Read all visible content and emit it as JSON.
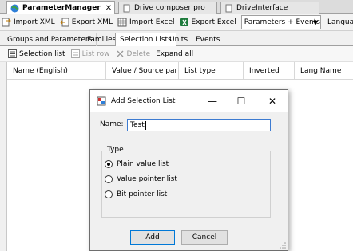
{
  "doc_tabs": [
    {
      "label": "ParameterManager",
      "active": true,
      "close": "✕"
    },
    {
      "label": "Drive composer pro",
      "active": false
    },
    {
      "label": "DriveInterface",
      "active": false
    }
  ],
  "toolbar": {
    "import_xml": "Import XML",
    "export_xml": "Export XML",
    "import_excel": "Import Excel",
    "export_excel": "Export Excel",
    "view_select": "Parameters + Events",
    "language_label": "Language"
  },
  "sub_tabs": [
    "Groups and Parameters",
    "Families",
    "Selection Lists",
    "Units",
    "Events"
  ],
  "actions": {
    "selection_list": "Selection list",
    "list_row": "List row",
    "delete": "Delete",
    "expand_all": "Expand all"
  },
  "grid": {
    "columns": [
      "Name (English)",
      "Value / Source par",
      "List type",
      "Inverted",
      "Lang Name"
    ]
  },
  "dialog": {
    "title": "Add Selection List",
    "minimize": "—",
    "maximize": "☐",
    "close": "✕",
    "name_label": "Name:",
    "name_value": "Test",
    "type_label": "Type",
    "options": [
      {
        "label": "Plain value list",
        "selected": true
      },
      {
        "label": "Value pointer list",
        "selected": false
      },
      {
        "label": "Bit pointer list",
        "selected": false
      }
    ],
    "add_button": "Add",
    "cancel_button": "Cancel"
  },
  "colors": {
    "accent": "#0078d7",
    "excel_green": "#1e7b3c"
  }
}
